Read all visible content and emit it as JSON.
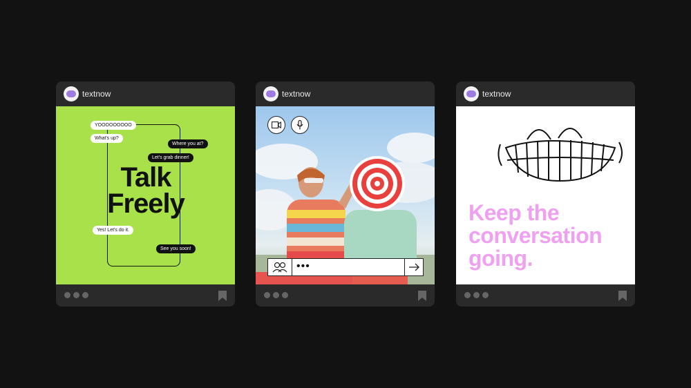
{
  "cards": [
    {
      "brand": "textnow",
      "messages": {
        "yo": "YOOOOOOOOO",
        "whats_up": "What's up?",
        "where": "Where you at?",
        "dinner": "Let's grab dinner!",
        "yes": "Yes! Let's do it.",
        "see": "See you soon!"
      },
      "headline_line1": "Talk",
      "headline_line2": "Freely"
    },
    {
      "brand": "textnow",
      "input_value": "•••"
    },
    {
      "brand": "textnow",
      "headline_line1": "Keep the",
      "headline_line2": "conversation",
      "headline_line3": "going."
    }
  ],
  "colors": {
    "background": "#121212",
    "card": "#2a2a2a",
    "green": "#a8e14a",
    "pink": "#f0a0f0",
    "avatar_accent": "#9d7be0"
  },
  "icons": [
    "textnow-logo-icon",
    "video-camera-icon",
    "microphone-icon",
    "users-icon",
    "send-arrow-icon",
    "more-dots-icon",
    "bookmark-icon",
    "smile-illustration"
  ]
}
